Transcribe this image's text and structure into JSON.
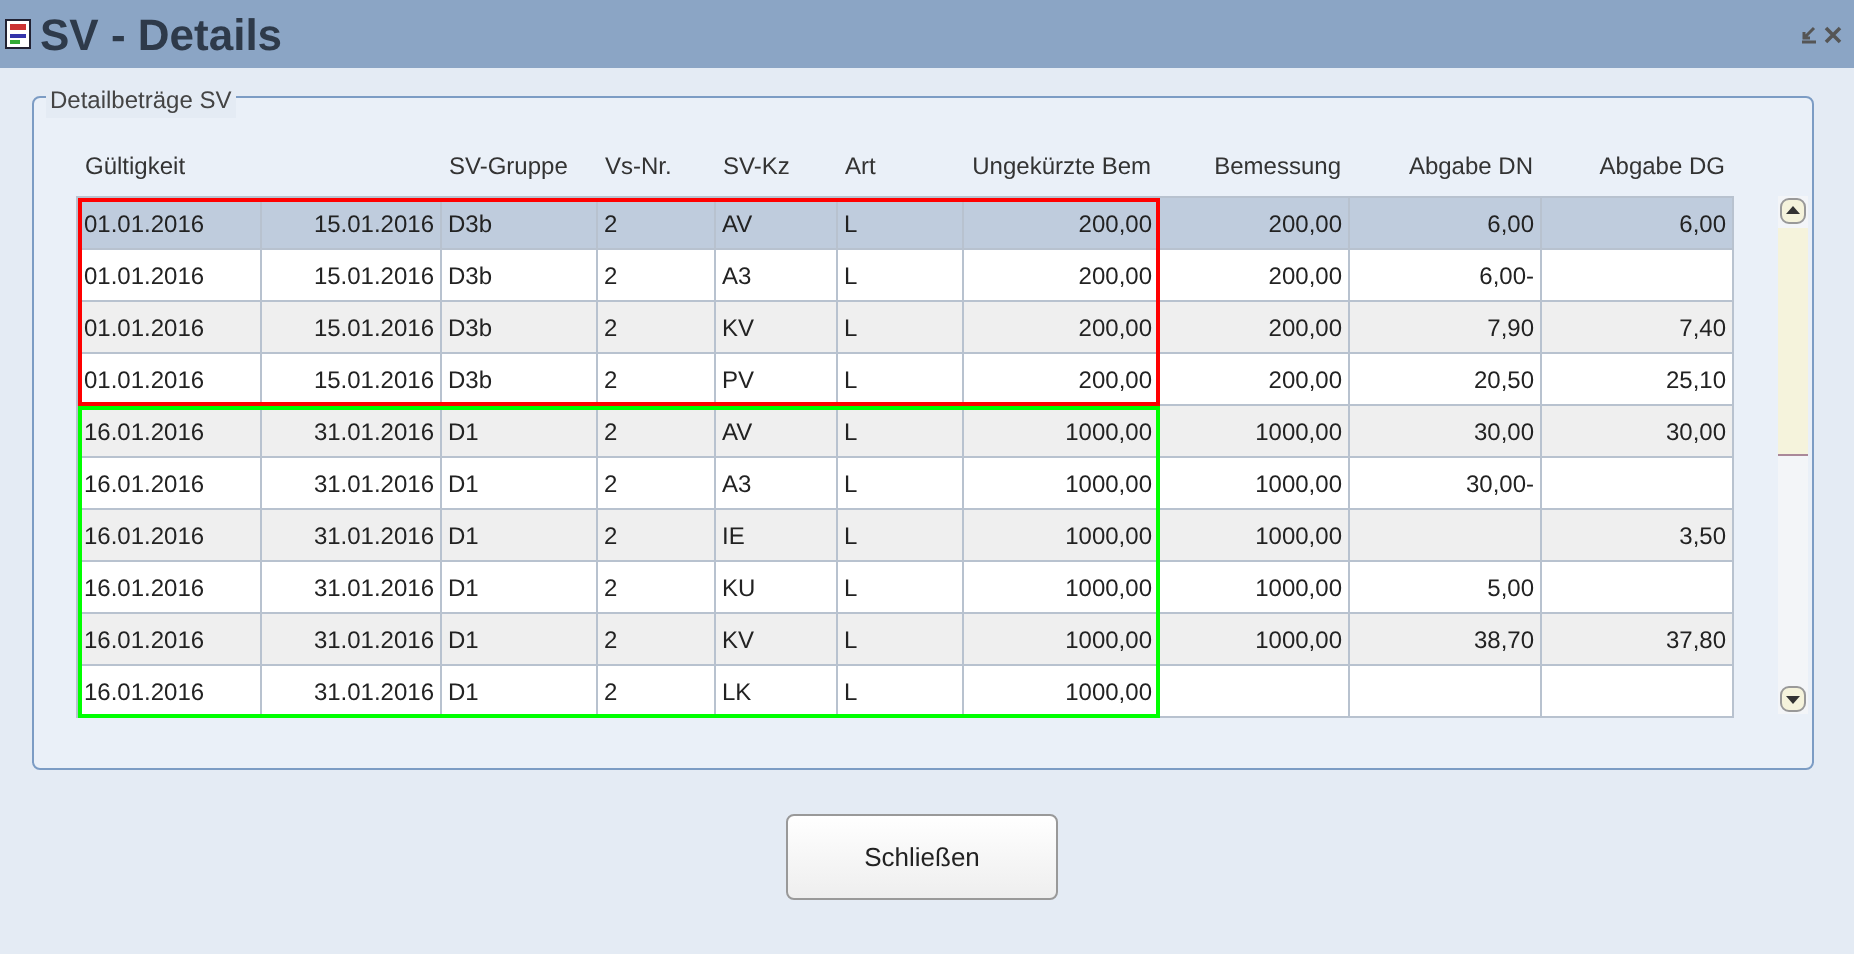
{
  "window": {
    "title": "SV - Details"
  },
  "fieldset": {
    "legend": "Detailbeträge SV"
  },
  "table": {
    "columns": [
      {
        "label": "Gültigkeit"
      },
      {
        "label": "SV-Gruppe"
      },
      {
        "label": "Vs-Nr."
      },
      {
        "label": "SV-Kz"
      },
      {
        "label": "Art"
      },
      {
        "label": "Ungekürzte Bem"
      },
      {
        "label": "Bemessung"
      },
      {
        "label": "Abgabe DN"
      },
      {
        "label": "Abgabe DG"
      }
    ],
    "row_groups": [
      {
        "color": "#ff0000",
        "rows": [
          {
            "selected": true,
            "cells": [
              "01.01.2016",
              "15.01.2016",
              "D3b",
              "2",
              "AV",
              "L",
              "200,00",
              "200,00",
              "6,00",
              "6,00"
            ]
          },
          {
            "selected": false,
            "cells": [
              "01.01.2016",
              "15.01.2016",
              "D3b",
              "2",
              "A3",
              "L",
              "200,00",
              "200,00",
              "6,00-",
              ""
            ]
          },
          {
            "selected": false,
            "cells": [
              "01.01.2016",
              "15.01.2016",
              "D3b",
              "2",
              "KV",
              "L",
              "200,00",
              "200,00",
              "7,90",
              "7,40"
            ]
          },
          {
            "selected": false,
            "cells": [
              "01.01.2016",
              "15.01.2016",
              "D3b",
              "2",
              "PV",
              "L",
              "200,00",
              "200,00",
              "20,50",
              "25,10"
            ]
          }
        ]
      },
      {
        "color": "#00ff00",
        "rows": [
          {
            "selected": false,
            "cells": [
              "16.01.2016",
              "31.01.2016",
              "D1",
              "2",
              "AV",
              "L",
              "1000,00",
              "1000,00",
              "30,00",
              "30,00"
            ]
          },
          {
            "selected": false,
            "cells": [
              "16.01.2016",
              "31.01.2016",
              "D1",
              "2",
              "A3",
              "L",
              "1000,00",
              "1000,00",
              "30,00-",
              ""
            ]
          },
          {
            "selected": false,
            "cells": [
              "16.01.2016",
              "31.01.2016",
              "D1",
              "2",
              "IE",
              "L",
              "1000,00",
              "1000,00",
              "",
              "3,50"
            ]
          },
          {
            "selected": false,
            "cells": [
              "16.01.2016",
              "31.01.2016",
              "D1",
              "2",
              "KU",
              "L",
              "1000,00",
              "1000,00",
              "5,00",
              ""
            ]
          },
          {
            "selected": false,
            "cells": [
              "16.01.2016",
              "31.01.2016",
              "D1",
              "2",
              "KV",
              "L",
              "1000,00",
              "1000,00",
              "38,70",
              "37,80"
            ]
          },
          {
            "selected": false,
            "cells": [
              "16.01.2016",
              "31.01.2016",
              "D1",
              "2",
              "LK",
              "L",
              "1000,00",
              "",
              "",
              ""
            ]
          }
        ]
      }
    ]
  },
  "buttons": [
    {
      "label": "Schließen"
    }
  ]
}
